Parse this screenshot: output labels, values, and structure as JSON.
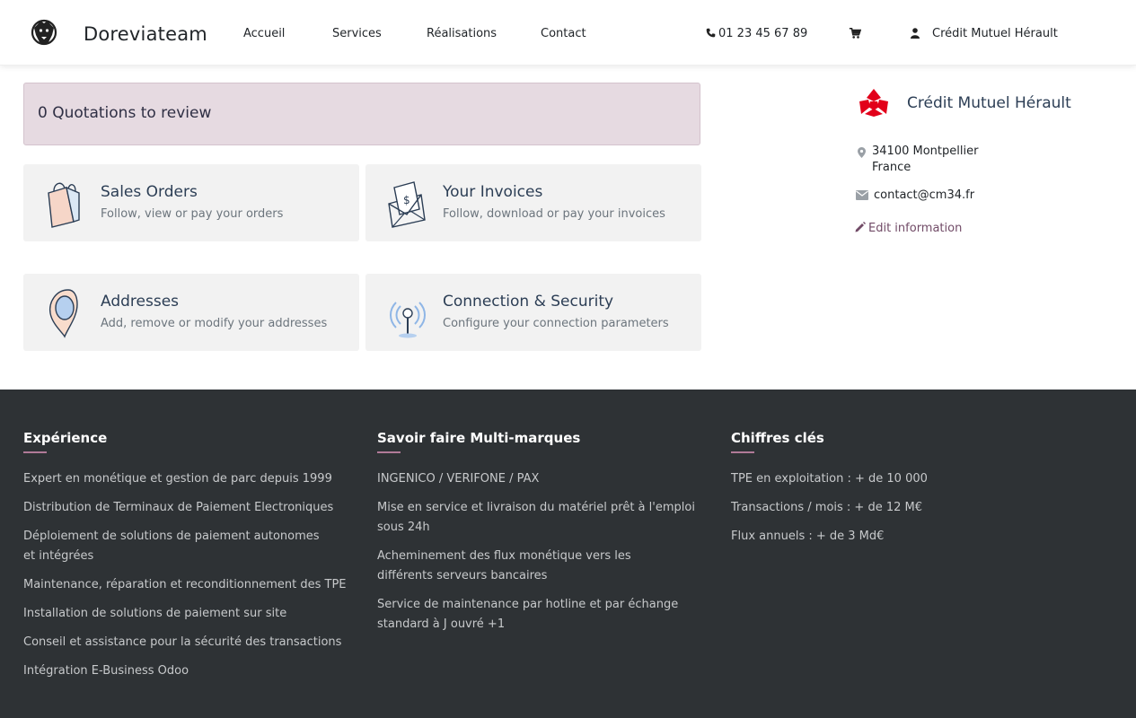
{
  "header": {
    "brand": "Doreviateam",
    "nav": [
      "Accueil",
      "Services",
      "Réalisations",
      "Contact"
    ],
    "phone": "01 23 45 67 89",
    "user": "Crédit Mutuel Hérault"
  },
  "quotations": {
    "count": "0",
    "label": "Quotations to review"
  },
  "cards": {
    "sales": {
      "title": "Sales Orders",
      "desc": "Follow, view or pay your orders"
    },
    "invoices": {
      "title": "Your Invoices",
      "desc": "Follow, download or pay your invoices"
    },
    "addresses": {
      "title": "Addresses",
      "desc": "Add, remove or modify your addresses"
    },
    "security": {
      "title": "Connection & Security",
      "desc": "Configure your connection parameters"
    }
  },
  "sidebar": {
    "company": "Crédit Mutuel Hérault",
    "address_line1": "34100 Montpellier",
    "address_line2": "France",
    "email": "contact@cm34.fr",
    "edit": "Edit information"
  },
  "footer": {
    "columns": [
      {
        "title": "Expérience",
        "items": [
          "Expert en monétique et gestion de parc depuis 1999",
          "Distribution de Terminaux de Paiement Electroniques",
          "Déploiement de solutions de paiement autonomes et intégrées",
          "Maintenance, réparation et reconditionnement des TPE",
          "Installation de solutions de paiement sur site",
          "Conseil et assistance pour la sécurité des transactions",
          "Intégration E-Business Odoo"
        ]
      },
      {
        "title": "Savoir faire Multi-marques",
        "items": [
          "INGENICO / VERIFONE / PAX",
          "Mise en service et livraison du matériel prêt à l'emploi sous 24h",
          "Acheminement des flux monétique vers les différents serveurs bancaires",
          "Service de maintenance par hotline et par échange standard à J ouvré +1"
        ]
      },
      {
        "title": "Chiffres clés",
        "items": [
          "TPE en exploitation : + de 10 000",
          "Transactions / mois : + de 12 M€",
          "Flux annuels : + de 3 Md€"
        ]
      }
    ]
  },
  "colors": {
    "accent": "#714b67",
    "quotes_bg": "#e6dae1",
    "footer_bg": "#2e3235",
    "logo_red": "#e2001a"
  },
  "icons": [
    "lion-logo-icon",
    "phone-icon",
    "cart-icon",
    "user-icon",
    "shopping-bag-icon",
    "invoice-envelope-icon",
    "map-pin-icon",
    "antenna-icon",
    "map-marker-icon",
    "envelope-icon",
    "pencil-icon"
  ]
}
